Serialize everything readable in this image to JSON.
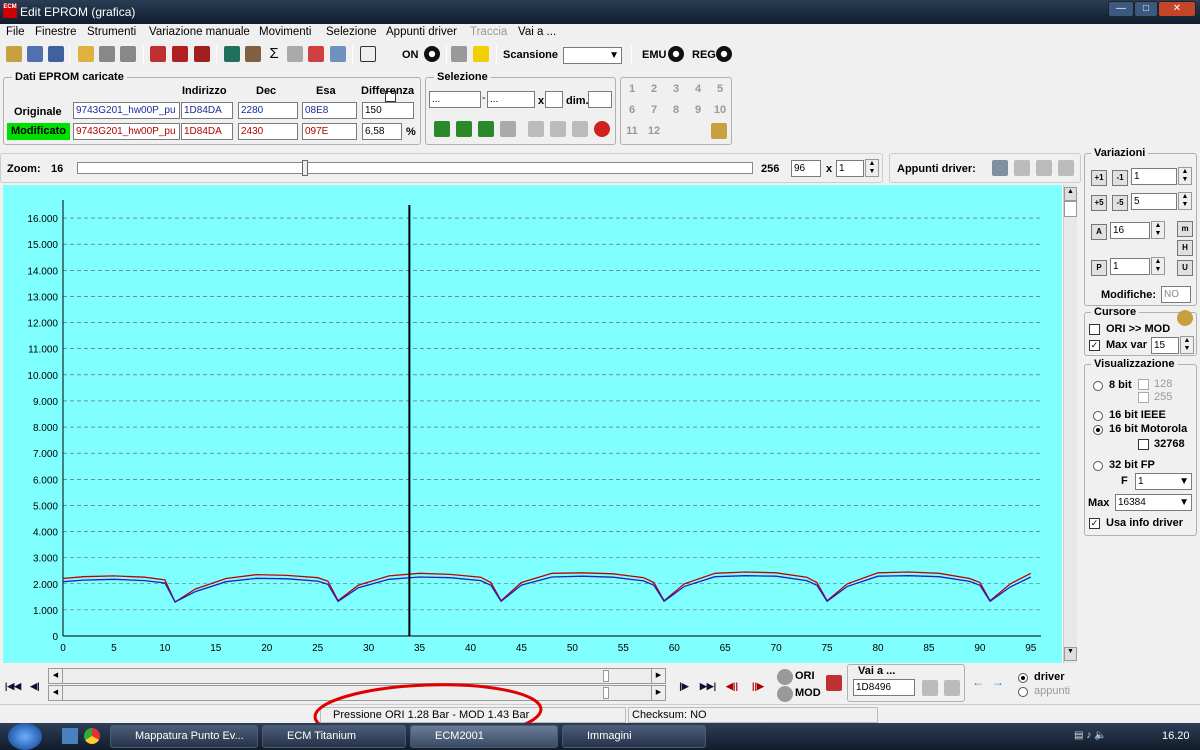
{
  "window": {
    "title": "Edit EPROM (grafica)",
    "app_icon_text": "ECM"
  },
  "menu": [
    "File",
    "Finestre",
    "Strumenti",
    "Variazione manuale",
    "Movimenti",
    "Selezione",
    "Appunti driver",
    "Traccia",
    "Vai a ..."
  ],
  "toolbar": {
    "on_label": "ON",
    "scansione_label": "Scansione",
    "emu_label": "EMU",
    "reg_label": "REG"
  },
  "eprom": {
    "group_title": "Dati EPROM caricate",
    "headers": {
      "indirizzo": "Indirizzo",
      "dec": "Dec",
      "esa": "Esa",
      "differenza": "Differenza"
    },
    "originale": {
      "label": "Originale",
      "file": "9743G201_hw00P_pu",
      "indirizzo": "1D84DA",
      "dec": "2280",
      "esa": "08E8",
      "differenza": "150"
    },
    "modificato": {
      "label": "Modificato",
      "file": "9743G201_hw00P_pu",
      "indirizzo": "1D84DA",
      "dec": "2430",
      "esa": "097E",
      "differenza": "6,58",
      "unit": "%"
    }
  },
  "selezione": {
    "title": "Selezione",
    "from": "...",
    "to": "...",
    "x_label": "x",
    "dim_label": "dim."
  },
  "keypad": [
    "1",
    "2",
    "3",
    "4",
    "5",
    "6",
    "7",
    "8",
    "9",
    "10",
    "11",
    "12"
  ],
  "zoom": {
    "label": "Zoom:",
    "value": "16",
    "max": "256",
    "field": "96",
    "x_label": "x",
    "mult": "1"
  },
  "appunti": {
    "label": "Appunti driver:"
  },
  "variazioni": {
    "title": "Variazioni",
    "v1": "1",
    "v2": "5",
    "v3": "16",
    "v4": "1",
    "modifiche_label": "Modifiche:",
    "modifiche_value": "NO"
  },
  "cursore": {
    "title": "Cursore",
    "ori_mod": "ORI >> MOD",
    "maxvar_label": "Max var",
    "maxvar_value": "15"
  },
  "visualizzazione": {
    "title": "Visualizzazione",
    "bit8": "8 bit",
    "v128": "128",
    "v255": "255",
    "bit16ieee": "16 bit IEEE",
    "bit16moto": "16 bit Motorola",
    "v32768": "32768",
    "bit32": "32 bit FP",
    "f_label": "F",
    "f_value": "1",
    "max_label": "Max",
    "max_value": "16384",
    "usa_info": "Usa info driver"
  },
  "bottom": {
    "ori": "ORI",
    "mod": "MOD",
    "vai_label": "Vai a ...",
    "vai_value": "1D8496",
    "driver": "driver",
    "appunti": "appunti"
  },
  "status": {
    "pressure": "Pressione ORI 1.28 Bar - MOD 1.43 Bar",
    "checksum": "Checksum: NO"
  },
  "taskbar": {
    "items": [
      "Mappatura Punto Ev...",
      "ECM Titanium",
      "ECM2001",
      "Immagini"
    ],
    "clock": "16.20"
  },
  "colors": {
    "plot_bg": "#80ffff",
    "ori_line": "#c00000",
    "mod_line": "#2020c0",
    "annotation": "#e00000"
  },
  "chart_data": {
    "type": "line",
    "xlim": [
      0,
      96
    ],
    "ylim": [
      0,
      16500
    ],
    "x_ticks": [
      "0",
      "5",
      "10",
      "15",
      "20",
      "25",
      "30",
      "35",
      "40",
      "45",
      "50",
      "55",
      "60",
      "65",
      "70",
      "75",
      "80",
      "85",
      "90",
      "95"
    ],
    "y_ticks": [
      "0",
      "1.000",
      "2.000",
      "3.000",
      "4.000",
      "5.000",
      "6.000",
      "7.000",
      "8.000",
      "9.000",
      "10.000",
      "11.000",
      "12.000",
      "13.000",
      "14.000",
      "15.000",
      "16.000"
    ],
    "cursor_x": 34,
    "series": [
      {
        "color": "#c00000",
        "x": [
          0,
          2,
          5,
          8,
          10,
          11,
          13,
          16,
          19,
          22,
          25,
          26,
          27,
          29,
          32,
          35,
          38,
          41,
          42,
          43,
          45,
          48,
          51,
          54,
          57,
          58,
          59,
          61,
          64,
          67,
          70,
          73,
          74,
          75,
          77,
          80,
          83,
          86,
          89,
          90,
          91,
          93,
          95
        ],
        "values": [
          2200,
          2270,
          2300,
          2250,
          2150,
          1300,
          1800,
          2200,
          2350,
          2320,
          2230,
          2100,
          1350,
          1950,
          2300,
          2400,
          2360,
          2250,
          2050,
          1350,
          2050,
          2400,
          2420,
          2380,
          2230,
          2050,
          1350,
          2000,
          2400,
          2450,
          2420,
          2250,
          2050,
          1350,
          2000,
          2420,
          2450,
          2400,
          2200,
          2050,
          1350,
          2000,
          2400
        ]
      },
      {
        "color": "#2020c0",
        "x": [
          0,
          2,
          5,
          8,
          10,
          11,
          13,
          16,
          19,
          22,
          25,
          26,
          27,
          29,
          32,
          35,
          38,
          41,
          42,
          43,
          45,
          48,
          51,
          54,
          57,
          58,
          59,
          61,
          64,
          67,
          70,
          73,
          74,
          75,
          77,
          80,
          83,
          86,
          89,
          90,
          91,
          93,
          95
        ],
        "values": [
          2080,
          2140,
          2170,
          2120,
          2030,
          1300,
          1700,
          2080,
          2210,
          2190,
          2100,
          1980,
          1320,
          1850,
          2170,
          2260,
          2230,
          2120,
          1940,
          1330,
          1950,
          2260,
          2290,
          2250,
          2110,
          1940,
          1330,
          1900,
          2270,
          2310,
          2290,
          2120,
          1940,
          1330,
          1900,
          2290,
          2310,
          2270,
          2090,
          1940,
          1330,
          1880,
          2260
        ]
      }
    ]
  }
}
